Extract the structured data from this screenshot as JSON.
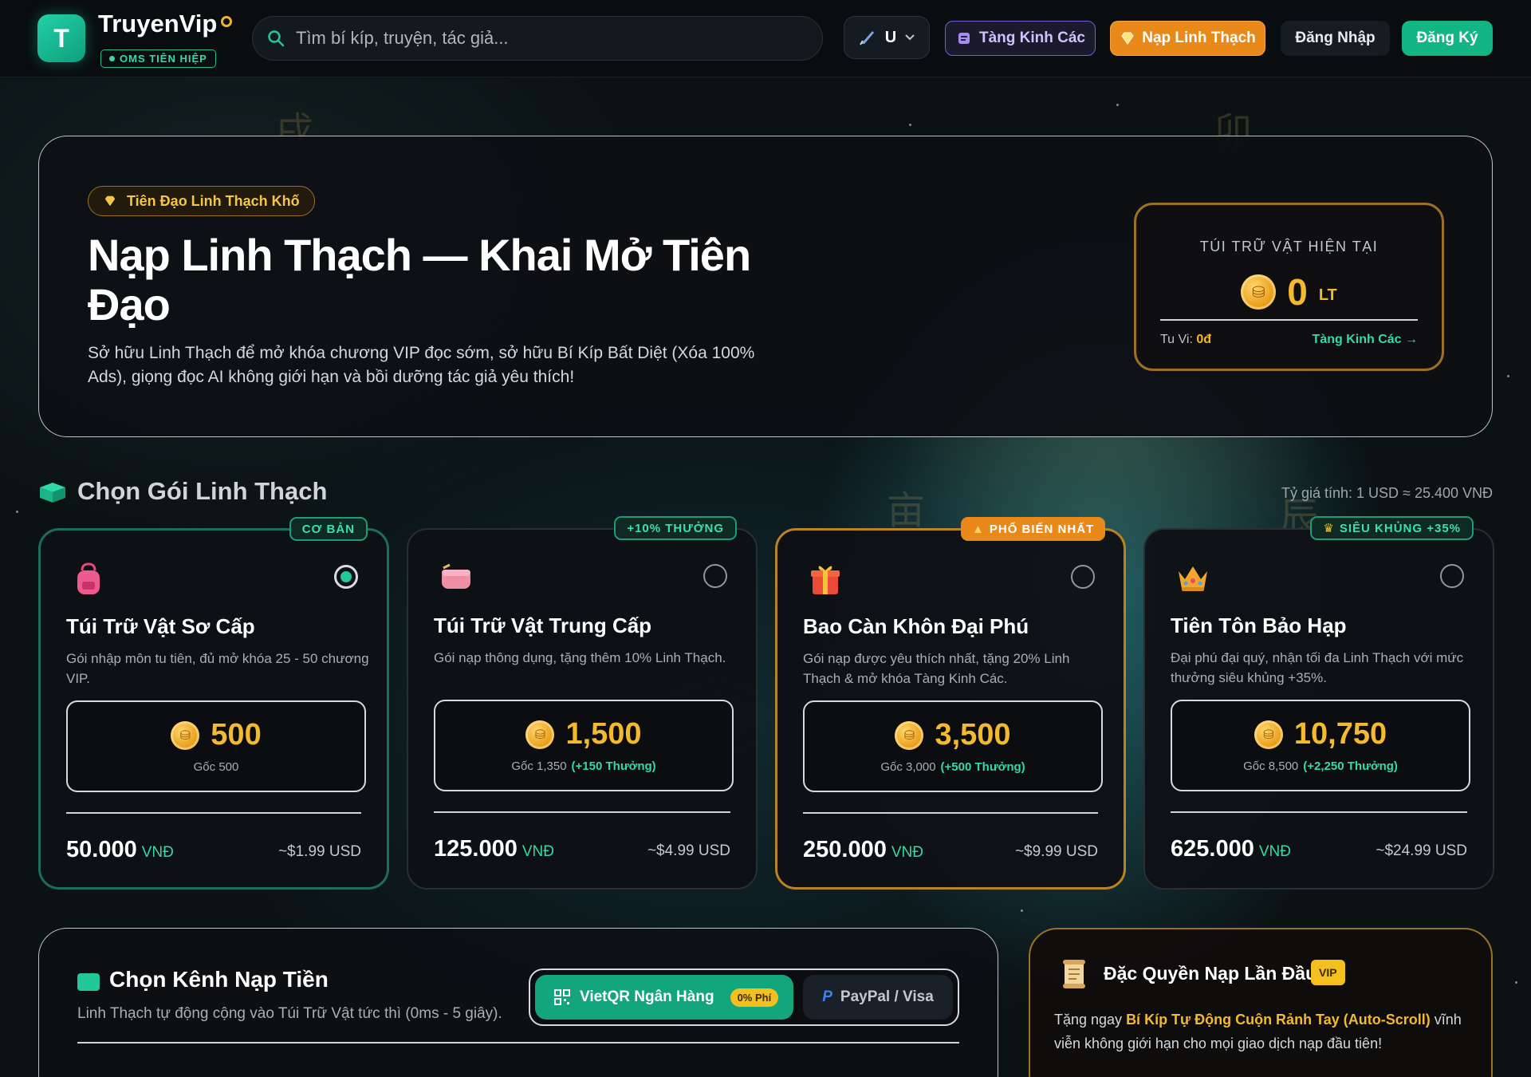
{
  "header": {
    "logo_letter": "T",
    "brand": "TruyenVip",
    "tagline": "OMS TIÊN HIỆP",
    "search_placeholder": "Tìm bí kíp, truyện, tác giả...",
    "user_initial": "U",
    "btn_tang_kinh_cac": "Tàng Kinh Các",
    "btn_nap_linh_thach": "Nạp Linh Thạch",
    "btn_dang_nhap": "Đăng Nhập",
    "btn_dang_ky": "Đăng Ký"
  },
  "hero": {
    "pill": "Tiên Đạo Linh Thạch Khố",
    "title": "Nạp Linh Thạch — Khai Mở Tiên Đạo",
    "description": "Sở hữu Linh Thạch để mở khóa chương VIP đọc sớm, sở hữu Bí Kíp Bất Diệt (Xóa 100% Ads), giọng đọc AI không giới hạn và bồi dưỡng tác giả yêu thích!",
    "wallet": {
      "title": "TÚI TRỮ VẬT HIỆN TẠI",
      "balance": "0",
      "unit": "LT",
      "tuvi_label": "Tu Vi:",
      "tuvi_value": "0đ",
      "link": "Tàng Kinh Các →"
    }
  },
  "packages": {
    "title": "Chọn Gói Linh Thạch",
    "rate": "Tỷ giá tính: 1 USD ≈ 25.400 VNĐ",
    "items": [
      {
        "badge": "CƠ BẢN",
        "icon": "backpack-icon",
        "name": "Túi Trữ Vật Sơ Cấp",
        "desc": "Gói nhập môn tu tiên, đủ mở khóa 25 - 50 chương VIP.",
        "amount": "500",
        "base": "Gốc 500",
        "bonus": "",
        "price": "50.000",
        "currency": "VNĐ",
        "usd": "~$1.99 USD",
        "selected": true
      },
      {
        "badge": "+10% THƯỞNG",
        "icon": "pouch-icon",
        "name": "Túi Trữ Vật Trung Cấp",
        "desc": "Gói nạp thông dụng, tặng thêm 10% Linh Thạch.",
        "amount": "1,500",
        "base": "Gốc 1,350",
        "bonus": "(+150 Thưởng)",
        "price": "125.000",
        "currency": "VNĐ",
        "usd": "~$4.99 USD",
        "selected": false
      },
      {
        "badge": "PHỔ BIẾN NHẤT",
        "icon": "gift-icon",
        "name": "Bao Càn Khôn Đại Phú",
        "desc": "Gói nạp được yêu thích nhất, tặng 20% Linh Thạch & mở khóa Tàng Kinh Các.",
        "amount": "3,500",
        "base": "Gốc 3,000",
        "bonus": "(+500 Thưởng)",
        "price": "250.000",
        "currency": "VNĐ",
        "usd": "~$9.99 USD",
        "selected": false
      },
      {
        "badge": "SIÊU KHỦNG +35%",
        "icon": "crown-icon",
        "name": "Tiên Tôn Bảo Hạp",
        "desc": "Đại phú đại quý, nhận tối đa Linh Thạch với mức thưởng siêu khủng +35%.",
        "amount": "10,750",
        "base": "Gốc 8,500",
        "bonus": "(+2,250 Thưởng)",
        "price": "625.000",
        "currency": "VNĐ",
        "usd": "~$24.99 USD",
        "selected": false
      }
    ]
  },
  "channel": {
    "title": "Chọn Kênh Nạp Tiền",
    "subtitle": "Linh Thạch tự động cộng vào Túi Trữ Vật tức thì (0ms - 5 giây).",
    "option1": "VietQR Ngân Hàng",
    "option1_fee": "0% Phí",
    "option2": "PayPal / Visa"
  },
  "first_topup": {
    "title": "Đặc Quyền Nạp Lần Đầu",
    "badge": "VIP",
    "text_before": "Tặng ngay ",
    "highlight": "Bí Kíp Tự Động Cuộn Rảnh Tay (Auto-Scroll)",
    "text_after": " vĩnh viễn không giới hạn cho mọi giao dịch nạp đầu tiên!"
  },
  "colors": {
    "accent_green": "#22c79a",
    "accent_gold": "#f3b92f",
    "accent_orange": "#e8891a",
    "accent_purple": "#7a5bd6"
  }
}
